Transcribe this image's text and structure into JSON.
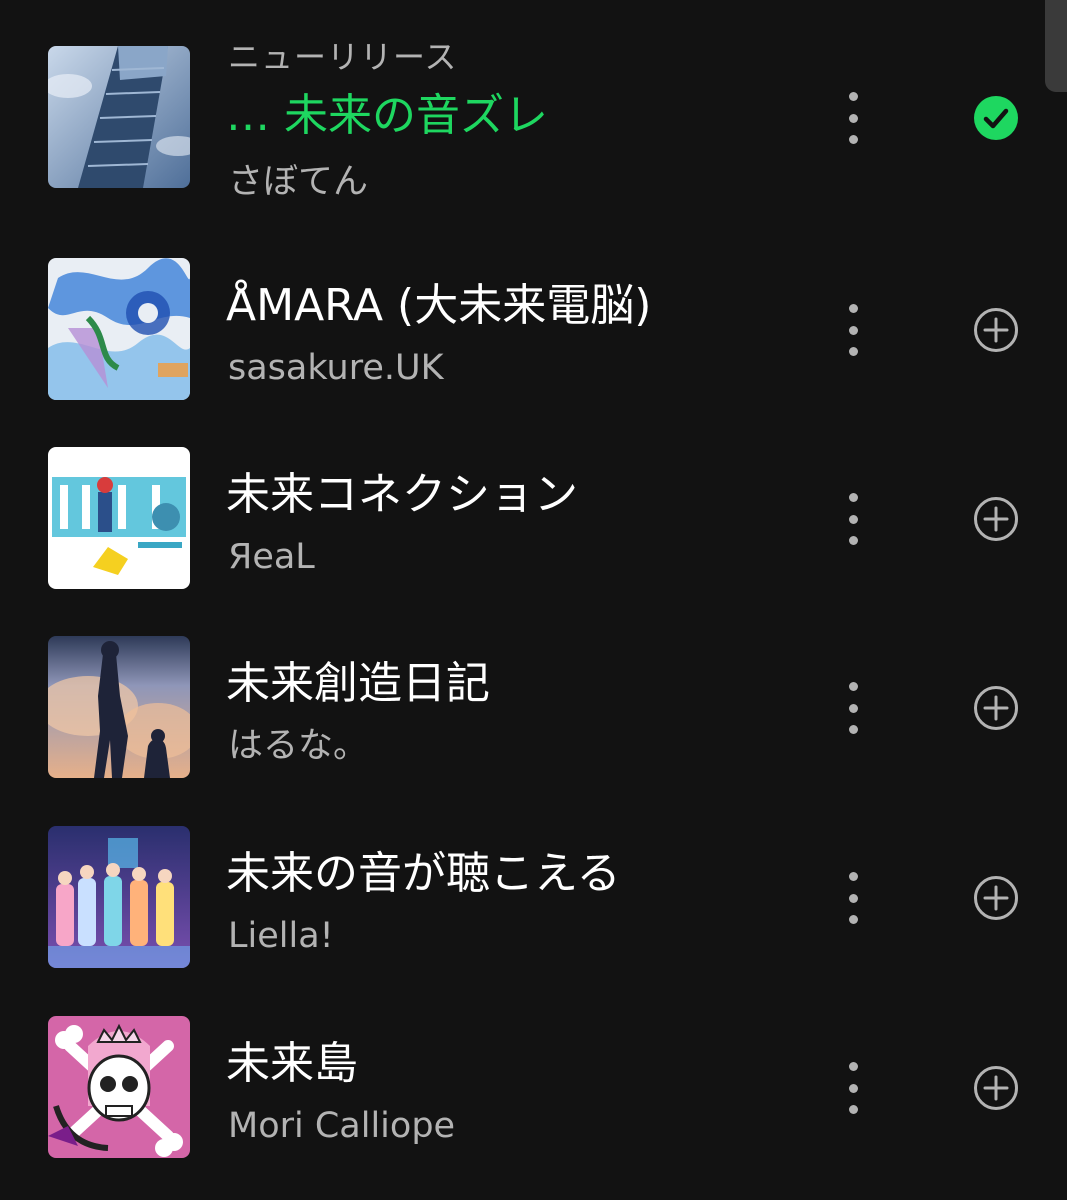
{
  "header": {
    "section_label": "ニューリリース"
  },
  "tracks": [
    {
      "title": "… 未来の音ズレ",
      "artist": "さぼてん",
      "state": "added",
      "action_icon": "check-circle-icon",
      "title_color": "#1ed760"
    },
    {
      "title": "ÅMARA (大未来電脳)",
      "artist": "sasakure.UK",
      "state": "not-added",
      "action_icon": "add-circle-icon"
    },
    {
      "title": "未来コネクション",
      "artist": "ЯeaL",
      "state": "not-added",
      "action_icon": "add-circle-icon"
    },
    {
      "title": "未来創造日記",
      "artist": "はるな。",
      "state": "not-added",
      "action_icon": "add-circle-icon"
    },
    {
      "title": "未来の音が聴こえる",
      "artist": "Liella!",
      "state": "not-added",
      "action_icon": "add-circle-icon"
    },
    {
      "title": "未来島",
      "artist": "Mori Calliope",
      "state": "not-added",
      "action_icon": "add-circle-icon"
    }
  ],
  "colors": {
    "background": "#121212",
    "accent": "#1ed760",
    "secondary_text": "#b3b3b3"
  }
}
